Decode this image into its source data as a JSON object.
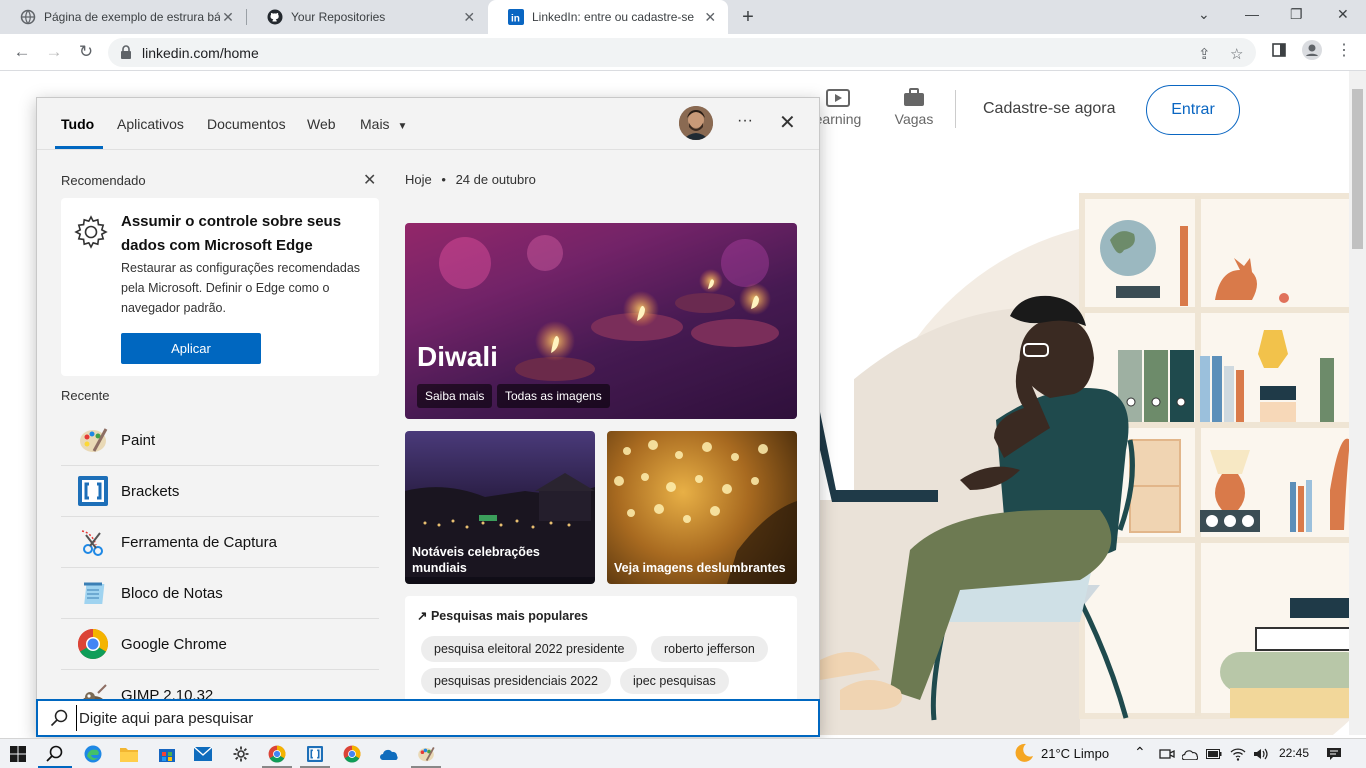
{
  "browser": {
    "tabs": [
      {
        "title": "Página de exemplo de estrura bá",
        "icon": "globe-icon"
      },
      {
        "title": "Your Repositories",
        "icon": "github-icon"
      },
      {
        "title": "LinkedIn: entre ou cadastre-se",
        "icon": "linkedin-icon"
      }
    ],
    "url": "linkedin.com/home"
  },
  "linkedin": {
    "nav": [
      {
        "label": "earning",
        "icon": "learning-icon"
      },
      {
        "label": "Vagas",
        "icon": "briefcase-icon"
      }
    ],
    "join": "Cadastre-se agora",
    "signin": "Entrar"
  },
  "panel": {
    "tabs": [
      "Tudo",
      "Aplicativos",
      "Documentos",
      "Web",
      "Mais"
    ],
    "recommended": {
      "heading": "Recomendado",
      "title": "Assumir o controle sobre seus dados com Microsoft Edge",
      "description": "Restaurar as configurações recomendadas pela Microsoft. Definir o Edge como o navegador padrão.",
      "button": "Aplicar"
    },
    "recent": {
      "heading": "Recente",
      "items": [
        "Paint",
        "Brackets",
        "Ferramenta de Captura",
        "Bloco de Notas",
        "Google Chrome",
        "GIMP 2.10.32"
      ]
    },
    "today": {
      "label": "Hoje",
      "date": "24 de outubro"
    },
    "hero": {
      "title": "Diwali",
      "button1": "Saiba mais",
      "button2": "Todas as imagens"
    },
    "cards": [
      {
        "title": "Notáveis celebrações mundiais"
      },
      {
        "title": "Veja imagens deslumbrantes"
      }
    ],
    "popular": {
      "title": "Pesquisas mais populares",
      "chips": [
        "pesquisa eleitoral 2022 presidente",
        "roberto jefferson",
        "pesquisas presidenciais 2022",
        "ipec pesquisas"
      ]
    }
  },
  "search": {
    "placeholder": "Digite aqui para pesquisar"
  },
  "taskbar": {
    "weather": "21°C  Limpo",
    "time": "22:45"
  },
  "colors": {
    "accent": "#0067c0",
    "linkedin_blue": "#0a66c2"
  }
}
